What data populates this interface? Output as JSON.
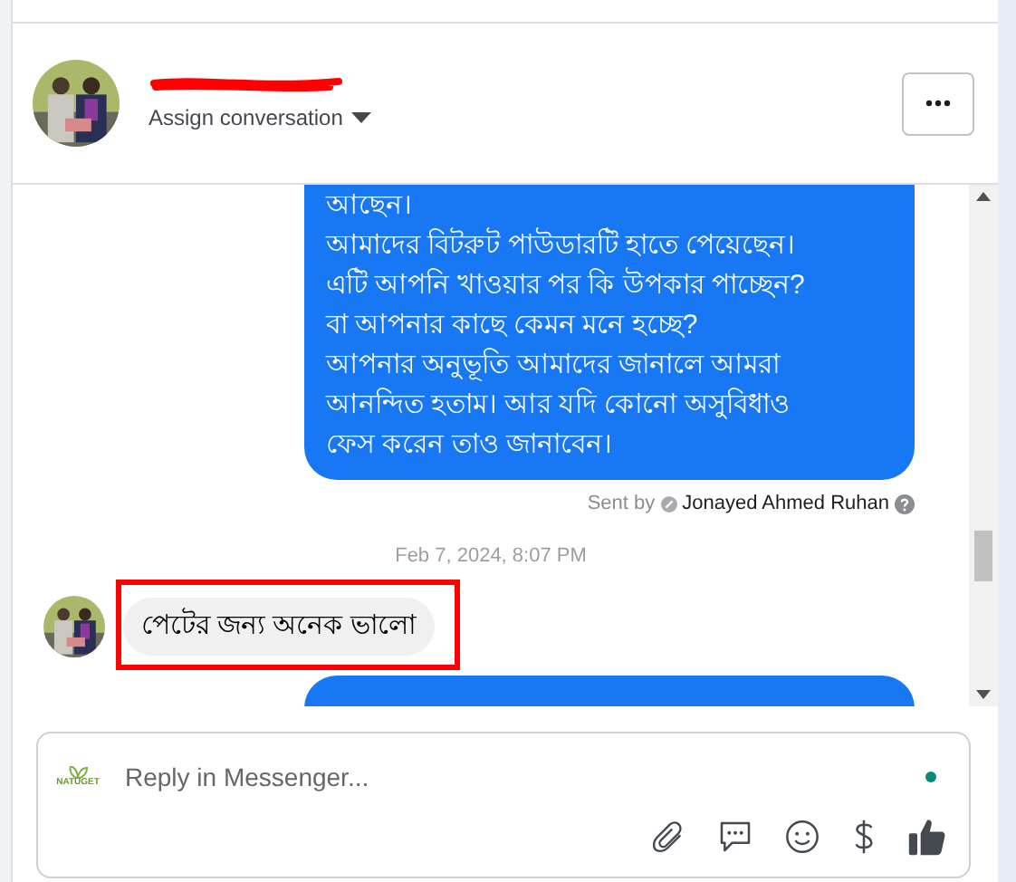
{
  "header": {
    "assign_label": "Assign conversation",
    "name_redacted": true
  },
  "messages": [
    {
      "kind": "outgoing",
      "lines": [
        "আছেন।",
        "আমাদের বিটরুট পাউডারটি হাতে পেয়েছেন।",
        "এটি আপনি খাওয়ার পর কি উপকার পাচ্ছেন?",
        "বা আপনার কাছে কেমন মনে হচ্ছে?",
        "আপনার অনুভূতি আমাদের জানালে আমরা",
        "আনন্দিত হতাম। আর যদি কোনো অসুবিধাও",
        "ফেস করেন তাও জানাবেন।"
      ],
      "sent_by_label": "Sent by",
      "sender": "Jonayed Ahmed Ruhan"
    },
    {
      "kind": "timestamp",
      "text": "Feb 7, 2024, 8:07 PM"
    },
    {
      "kind": "incoming",
      "lines": [
        "পেটের জন্য অনেক ভালো"
      ],
      "highlighted": true
    },
    {
      "kind": "outgoing"
    }
  ],
  "composer": {
    "logo": "NATUGET",
    "placeholder": "Reply in Messenger..."
  }
}
